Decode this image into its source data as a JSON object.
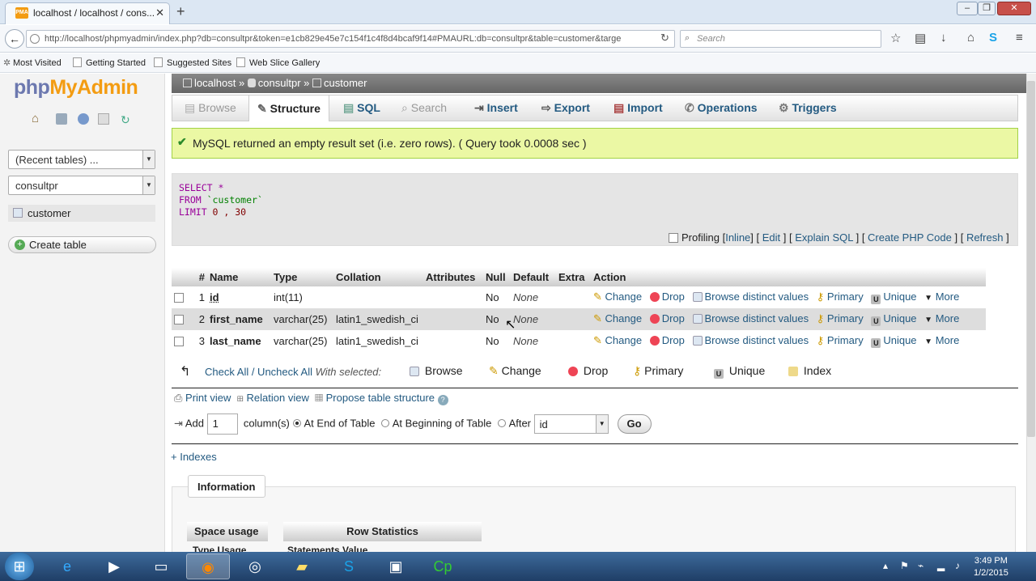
{
  "browser": {
    "tab_title": "localhost / localhost / cons...",
    "url": "http://localhost/phpmyadmin/index.php?db=consultpr&token=e1cb829e45e7c154f1c4f8d4bcaf9f14#PMAURL:db=consultpr&table=customer&targe",
    "search_placeholder": "Search",
    "bookmarks": [
      "Most Visited",
      "Getting Started",
      "Suggested Sites",
      "Web Slice Gallery"
    ]
  },
  "left": {
    "logo_php": "php",
    "logo_rest": "MyAdmin",
    "recent_tables": "(Recent tables) ...",
    "database": "consultpr",
    "table_item": "customer",
    "create_table": "Create table"
  },
  "breadcrumb": {
    "server": "localhost",
    "db": "consultpr",
    "table": "customer",
    "sep": "»"
  },
  "menu": [
    "Browse",
    "Structure",
    "SQL",
    "Search",
    "Insert",
    "Export",
    "Import",
    "Operations",
    "Triggers"
  ],
  "success_msg": "MySQL returned an empty result set (i.e. zero rows). ( Query took 0.0008 sec )",
  "sql": {
    "l1_kw": "SELECT",
    "l1_rest": " *",
    "l2_kw": "FROM",
    "l2_rest": " `customer`",
    "l3_kw": "LIMIT",
    "l3_rest": " 0 , 30"
  },
  "profiling": {
    "label": "Profiling",
    "inline": "Inline",
    "edit": "Edit",
    "explain": "Explain SQL",
    "php": "Create PHP Code",
    "refresh": "Refresh"
  },
  "table": {
    "headers": [
      "#",
      "Name",
      "Type",
      "Collation",
      "Attributes",
      "Null",
      "Default",
      "Extra",
      "Action"
    ],
    "rows": [
      {
        "num": "1",
        "name": "id",
        "type": "int(11)",
        "collation": "",
        "attributes": "",
        "null": "No",
        "default": "None",
        "extra": ""
      },
      {
        "num": "2",
        "name": "first_name",
        "type": "varchar(25)",
        "collation": "latin1_swedish_ci",
        "attributes": "",
        "null": "No",
        "default": "None",
        "extra": ""
      },
      {
        "num": "3",
        "name": "last_name",
        "type": "varchar(25)",
        "collation": "latin1_swedish_ci",
        "attributes": "",
        "null": "No",
        "default": "None",
        "extra": ""
      }
    ],
    "actions": {
      "change": "Change",
      "drop": "Drop",
      "browse": "Browse distinct values",
      "primary": "Primary",
      "unique": "Unique",
      "more": "More"
    }
  },
  "bulk": {
    "checkall": "Check All / Uncheck All",
    "with_selected": "With selected:",
    "browse": "Browse",
    "change": "Change",
    "drop": "Drop",
    "primary": "Primary",
    "unique": "Unique",
    "index": "Index"
  },
  "tools": {
    "print": "Print view",
    "relation": "Relation view",
    "propose": "Propose table structure"
  },
  "add": {
    "label": "Add",
    "count": "1",
    "columns": "column(s)",
    "end": "At End of Table",
    "beginning": "At Beginning of Table",
    "after": "After",
    "after_value": "id",
    "go": "Go"
  },
  "indexes": "+ Indexes",
  "info": {
    "legend": "Information",
    "space_usage": "Space usage",
    "row_stats": "Row Statistics",
    "cut_left": "Type   Usage",
    "cut_right": "Statements   Value"
  },
  "clock": {
    "time": "3:49 PM",
    "date": "1/2/2015"
  },
  "colors": {
    "accent": "#235a81",
    "success_bg": "#ebf8a4",
    "logo_orange": "#f39c12",
    "logo_blue": "#6c78af"
  }
}
